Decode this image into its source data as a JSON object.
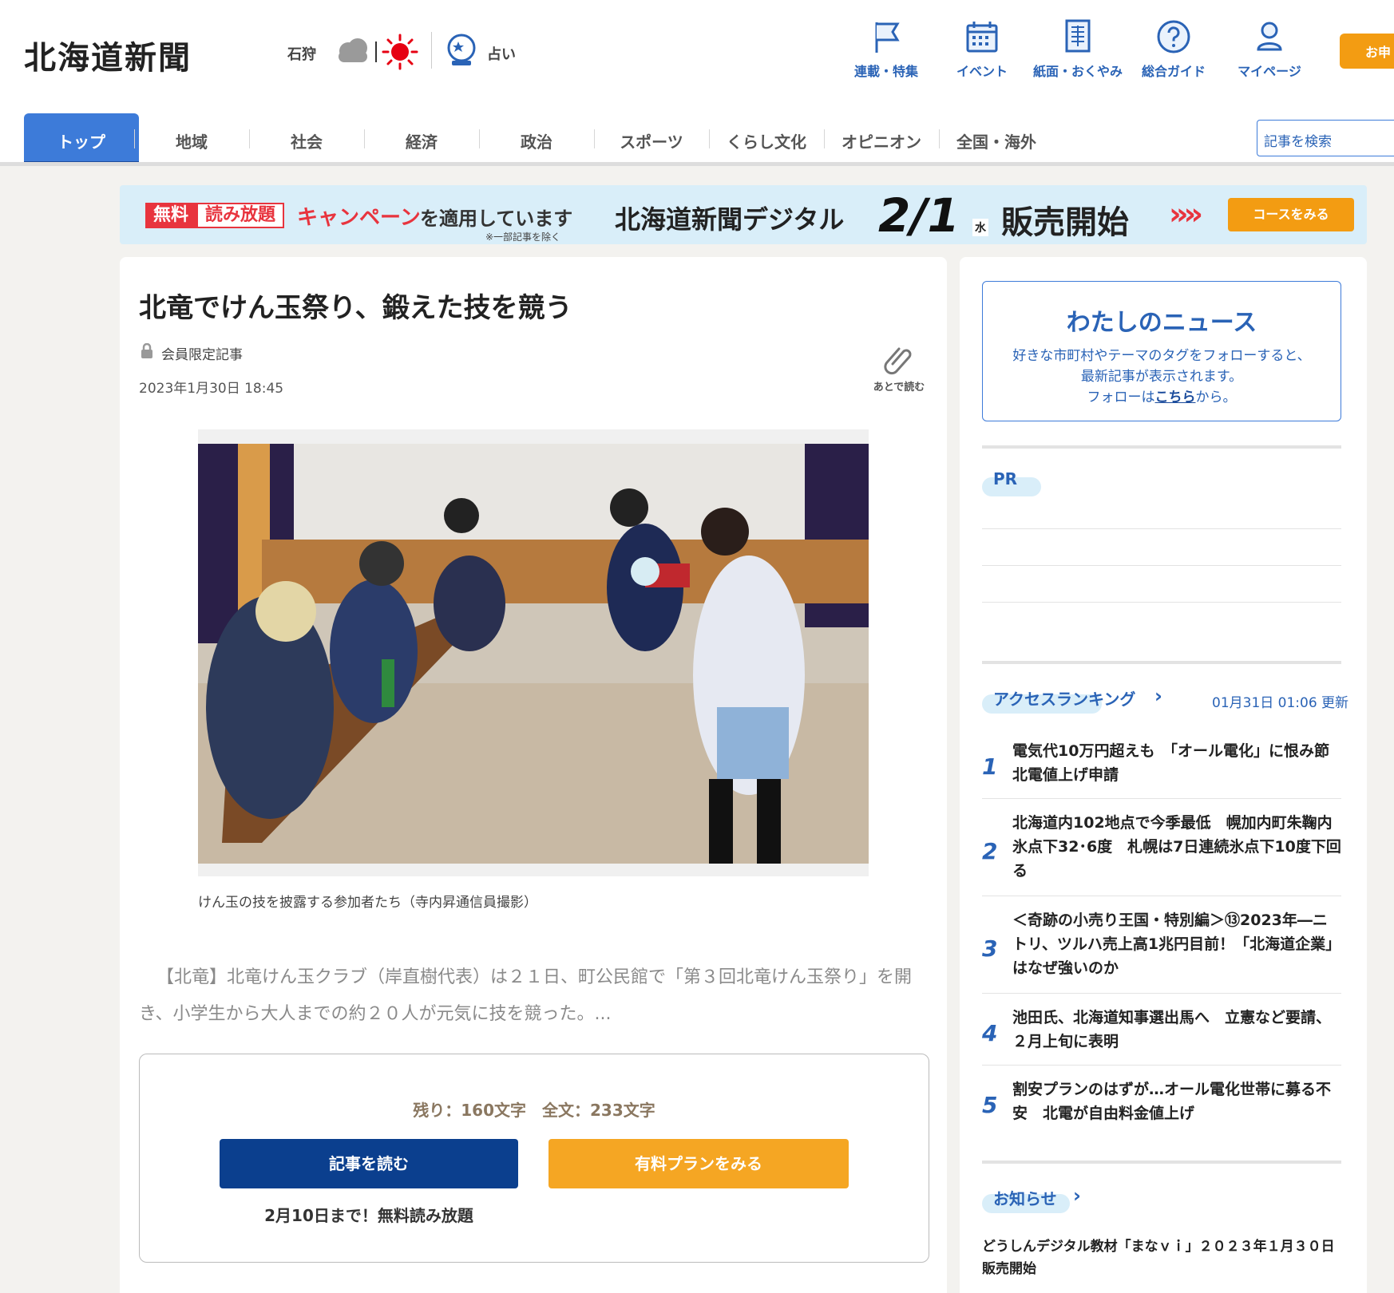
{
  "header": {
    "logo": "北海道新聞",
    "weather_location": "石狩",
    "fortune_label": "占い",
    "utility_nav": [
      {
        "label": "連載・特集",
        "icon": "flag-icon"
      },
      {
        "label": "イベント",
        "icon": "calendar-icon"
      },
      {
        "label": "紙面・おくやみ",
        "icon": "newspaper-icon"
      },
      {
        "label": "総合ガイド",
        "icon": "help-icon"
      },
      {
        "label": "マイページ",
        "icon": "user-icon"
      }
    ],
    "apply_label": "お申"
  },
  "nav": {
    "tabs": [
      "トップ",
      "地域",
      "社会",
      "経済",
      "政治",
      "スポーツ",
      "くらし文化",
      "オピニオン",
      "全国・海外"
    ],
    "search_placeholder": "記事を検索"
  },
  "banner": {
    "free": "無料",
    "unlimited": "読み放題",
    "campaign": "キャンペーン",
    "applied": "を適用しています",
    "note": "※一部記事を除く",
    "digital": "北海道新聞デジタル",
    "date": "2/1",
    "dow": "水",
    "launch": "販売開始",
    "arrows": "»»",
    "course_button": "コースをみる"
  },
  "article": {
    "title": "北竜でけん玉祭り、鍛えた技を競う",
    "member_label": "会員限定記事",
    "date": "2023年1月30日 18:45",
    "read_later": "あとで読む",
    "caption": "けん玉の技を披露する参加者たち（寺内昇通信員撮影）",
    "body": "【北竜】北竜けん玉クラブ（岸直樹代表）は２１日、町公民館で「第３回北竜けん玉祭り」を開き、小学生から大人までの約２０人が元気に技を競った。...",
    "paywall": {
      "remaining": "残り：160文字　全文：233文字",
      "read_button": "記事を読む",
      "plan_button": "有料プランをみる",
      "free_note": "2月10日まで！無料読み放題"
    }
  },
  "sidebar": {
    "mynews": {
      "title": "わたしのニュース",
      "line1": "好きな市町村やテーマのタグをフォローすると、",
      "line2": "最新記事が表示されます。",
      "line3_pre": "フォローは",
      "line3_link": "こちら",
      "line3_post": "から。"
    },
    "pr_label": "PR",
    "ranking": {
      "label": "アクセスランキング",
      "updated": "01月31日 01:06 更新",
      "items": [
        {
          "rank": "1",
          "title": "電気代10万円超えも　「オール電化」に恨み節　北電値上げ申請"
        },
        {
          "rank": "2",
          "title": "北海道内102地点で今季最低　幌加内町朱鞠内氷点下32･6度　札幌は7日連続氷点下10度下回る"
        },
        {
          "rank": "3",
          "title": "＜奇跡の小売り王国・特別編＞⑬2023年―ニトリ、ツルハ売上高1兆円目前！「北海道企業」はなぜ強いのか"
        },
        {
          "rank": "4",
          "title": "池田氏、北海道知事選出馬へ　立憲など要請、２月上旬に表明"
        },
        {
          "rank": "5",
          "title": "割安プランのはずが…オール電化世帯に募る不安　北電が自由料金値上げ"
        }
      ]
    },
    "notice": {
      "label": "お知らせ",
      "item": "どうしんデジタル教材「まなｖｉ」２０２３年１月３０日販売開始"
    }
  }
}
